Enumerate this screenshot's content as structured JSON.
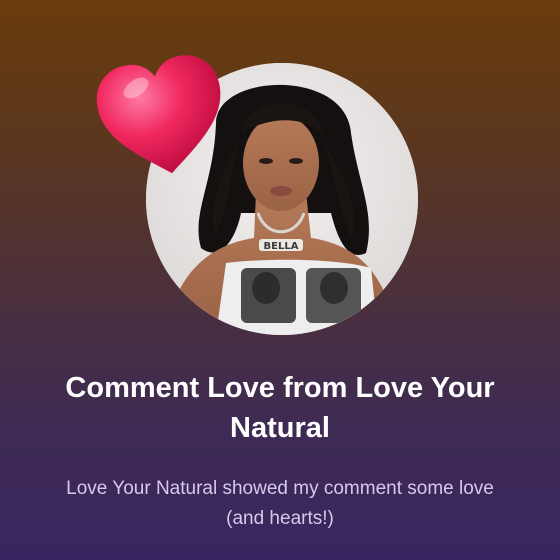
{
  "notification": {
    "title": "Comment Love from Love Your Natural",
    "message": "Love Your Natural showed my comment some love (and hearts!)",
    "avatar_alt": "profile photo",
    "necklace_text": "BELLA",
    "badge_icon": "heart-icon"
  },
  "colors": {
    "background_top": "#6a3c0b",
    "background_bottom": "#392660",
    "heart": "#f0285f",
    "subtitle_text": "#d8c8ea"
  }
}
